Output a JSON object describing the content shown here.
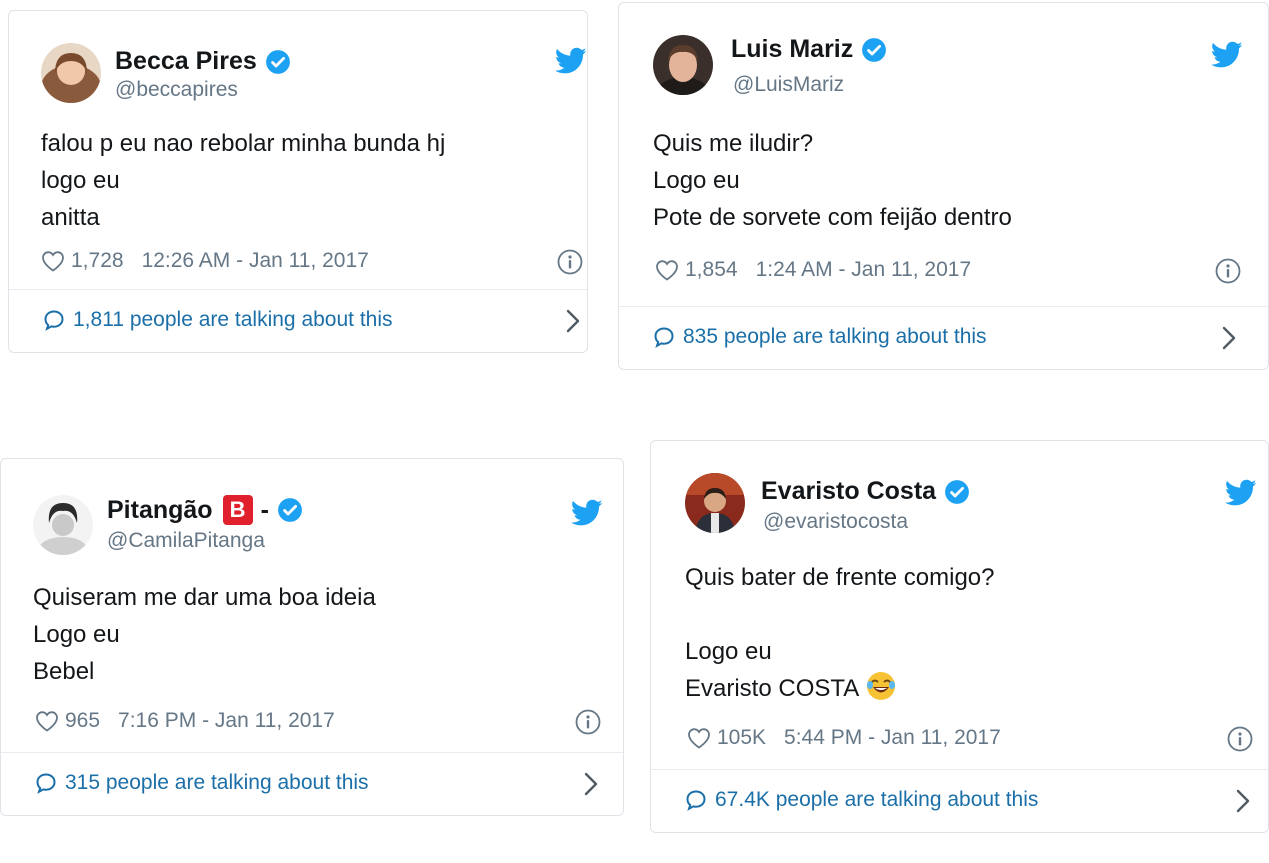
{
  "colors": {
    "twitter_blue": "#1da1f2",
    "link_blue": "#1b6fa8",
    "gray_text": "#657786",
    "border": "#dfe3e8"
  },
  "tweets": [
    {
      "name": "Becca Pires",
      "handle": "@beccapires",
      "verified": true,
      "lines": [
        "falou p eu nao rebolar minha bunda hj",
        "logo eu",
        "anitta"
      ],
      "likes": "1,728",
      "time": "12:26 AM - Jan 11, 2017",
      "talking": "1,811 people are talking about this",
      "icons": [
        "avatar",
        "verified-icon",
        "twitter-bird-icon",
        "heart-icon",
        "info-icon",
        "comment-bubble-icon",
        "chevron-right-icon"
      ]
    },
    {
      "name": "Luis Mariz",
      "handle": "@LuisMariz",
      "verified": true,
      "lines": [
        "Quis me iludir?",
        "Logo eu",
        "Pote de sorvete com feijão dentro"
      ],
      "likes": "1,854",
      "time": "1:24 AM - Jan 11, 2017",
      "talking": "835 people are talking about this",
      "icons": [
        "avatar",
        "verified-icon",
        "twitter-bird-icon",
        "heart-icon",
        "info-icon",
        "comment-bubble-icon",
        "chevron-right-icon"
      ]
    },
    {
      "name": "Pitangão",
      "name_badge": "B",
      "name_suffix": "-",
      "handle": "@CamilaPitanga",
      "verified": true,
      "lines": [
        "Quiseram me dar uma boa ideia",
        "Logo eu",
        "Bebel"
      ],
      "likes": "965",
      "time": "7:16 PM - Jan 11, 2017",
      "talking": "315 people are talking about this",
      "icons": [
        "avatar",
        "letter-b-badge-icon",
        "verified-icon",
        "twitter-bird-icon",
        "heart-icon",
        "info-icon",
        "comment-bubble-icon",
        "chevron-right-icon"
      ]
    },
    {
      "name": "Evaristo Costa",
      "handle": "@evaristocosta",
      "verified": true,
      "lines": [
        "Quis bater de frente comigo?",
        "",
        "Logo eu",
        "Evaristo COSTA"
      ],
      "emoji": "tears-of-joy-emoji",
      "likes": "105K",
      "time": "5:44 PM - Jan 11, 2017",
      "talking": "67.4K people are talking about this",
      "icons": [
        "avatar",
        "verified-icon",
        "twitter-bird-icon",
        "heart-icon",
        "info-icon",
        "comment-bubble-icon",
        "chevron-right-icon"
      ]
    }
  ]
}
